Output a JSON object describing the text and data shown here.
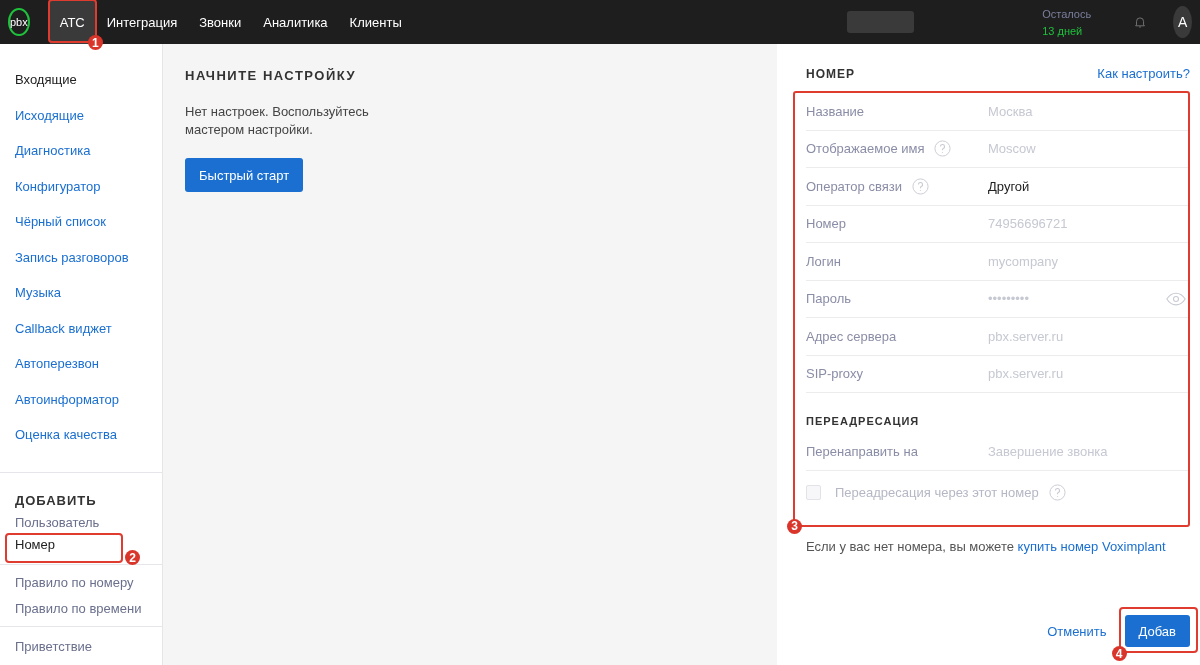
{
  "topbar": {
    "logo": "pbx",
    "tabs": [
      {
        "label": "АТС",
        "selected": true,
        "callout": "1"
      },
      {
        "label": "Интеграция",
        "selected": false
      },
      {
        "label": "Звонки",
        "selected": false
      },
      {
        "label": "Аналитика",
        "selected": false
      },
      {
        "label": "Клиенты",
        "selected": false
      }
    ],
    "trial": {
      "label": "Осталось",
      "days": "13 дней"
    },
    "avatar": "А"
  },
  "sidebar": {
    "menu": [
      {
        "label": "Входящие",
        "selected": true
      },
      {
        "label": "Исходящие",
        "selected": false
      },
      {
        "label": "Диагностика",
        "selected": false
      },
      {
        "label": "Конфигуратор",
        "selected": false
      },
      {
        "label": "Чёрный список",
        "selected": false
      },
      {
        "label": "Запись разговоров",
        "selected": false
      },
      {
        "label": "Музыка",
        "selected": false
      },
      {
        "label": "Callback виджет",
        "selected": false
      },
      {
        "label": "Автоперезвон",
        "selected": false
      },
      {
        "label": "Автоинформатор",
        "selected": false
      },
      {
        "label": "Оценка качества",
        "selected": false
      }
    ],
    "add_title": "ДОБАВИТЬ",
    "add_items": [
      {
        "label": "Пользователь",
        "selected": false
      },
      {
        "label": "Номер",
        "selected": true,
        "callout": "2"
      }
    ],
    "rules": [
      {
        "label": "Правило по номеру",
        "selected": false
      },
      {
        "label": "Правило по времени",
        "selected": false
      }
    ],
    "more": [
      {
        "label": "Приветствие",
        "selected": false
      }
    ]
  },
  "main": {
    "title": "НАЧНИТЕ НАСТРОЙКУ",
    "text": "Нет настроек. Воспользуйтесь мастером настройки.",
    "button": "Быстрый старт"
  },
  "panel": {
    "title": "НОМЕР",
    "help_link": "Как настроить?",
    "callout": "3",
    "fields": [
      {
        "kind": "text",
        "label": "Название",
        "help": false,
        "placeholder": "Москва"
      },
      {
        "kind": "text",
        "label": "Отображаемое имя",
        "help": true,
        "placeholder": "Moscow"
      },
      {
        "kind": "text",
        "label": "Оператор связи",
        "help": true,
        "value": "Другой"
      },
      {
        "kind": "text",
        "label": "Номер",
        "help": false,
        "placeholder": "74956696721"
      },
      {
        "kind": "text",
        "label": "Логин",
        "help": false,
        "placeholder": "mycompany"
      },
      {
        "kind": "password",
        "label": "Пароль",
        "help": false,
        "placeholder": "•••••••••"
      },
      {
        "kind": "text",
        "label": "Адрес сервера",
        "help": false,
        "placeholder": "pbx.server.ru"
      },
      {
        "kind": "text",
        "label": "SIP-proxy",
        "help": false,
        "placeholder": "pbx.server.ru"
      }
    ],
    "redirect_title": "ПЕРЕАДРЕСАЦИЯ",
    "redirect_field": {
      "label": "Перенаправить на",
      "placeholder": "Завершение звонка"
    },
    "redirect_check": {
      "label": "Переадресация через этот номер",
      "checked": false,
      "disabled": true
    },
    "note": "Если у вас нет номера, вы можете",
    "note_link": "купить номер Voximplant",
    "cancel": "Отменить",
    "submit": "Добав",
    "submit_callout": "4"
  }
}
